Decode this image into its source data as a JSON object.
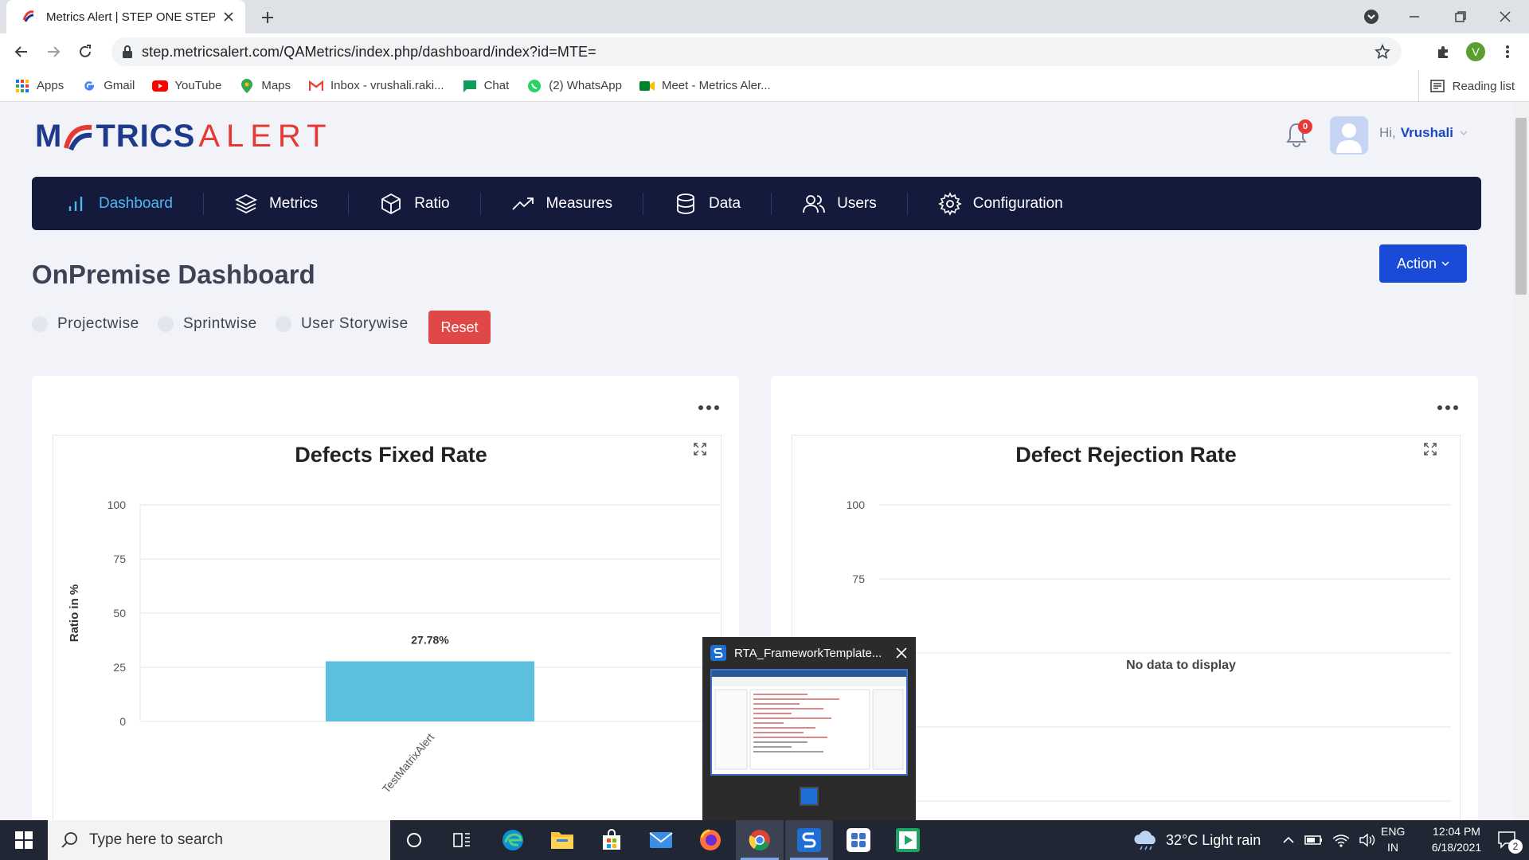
{
  "browser": {
    "tab_title": "Metrics Alert | STEP ONE STEP AHEAD",
    "url": "step.metricsalert.com/QAMetrics/index.php/dashboard/index?id=MTE=",
    "profile_initial": "V",
    "reading_list": "Reading list",
    "bookmarks": [
      {
        "label": "Apps",
        "icon": "apps-grid-icon"
      },
      {
        "label": "Gmail",
        "icon": "google-icon"
      },
      {
        "label": "YouTube",
        "icon": "youtube-icon"
      },
      {
        "label": "Maps",
        "icon": "maps-pin-icon"
      },
      {
        "label": "Inbox - vrushali.raki...",
        "icon": "gmail-icon"
      },
      {
        "label": "Chat",
        "icon": "chat-icon"
      },
      {
        "label": "(2) WhatsApp",
        "icon": "whatsapp-icon"
      },
      {
        "label": "Meet - Metrics Aler...",
        "icon": "meet-icon"
      }
    ]
  },
  "header": {
    "logo_part1": "M",
    "logo_part2": "TRICS",
    "logo_part3": "ALERT",
    "notification_count": "0",
    "greeting": "Hi,",
    "user_name": "Vrushali"
  },
  "nav": [
    {
      "label": "Dashboard",
      "icon": "bar-chart-icon",
      "active": true
    },
    {
      "label": "Metrics",
      "icon": "layers-icon"
    },
    {
      "label": "Ratio",
      "icon": "cube-icon"
    },
    {
      "label": "Measures",
      "icon": "trending-up-icon"
    },
    {
      "label": "Data",
      "icon": "database-icon"
    },
    {
      "label": "Users",
      "icon": "users-icon"
    },
    {
      "label": "Configuration",
      "icon": "gear-icon"
    }
  ],
  "dashboard": {
    "title": "OnPremise Dashboard",
    "action_label": "Action",
    "filters": [
      "Projectwise",
      "Sprintwise",
      "User Storywise"
    ],
    "reset_label": "Reset"
  },
  "chart_data": [
    {
      "type": "bar",
      "title": "Defects Fixed Rate",
      "ylabel": "Ratio in %",
      "xlabel": "",
      "ylim": [
        0,
        100
      ],
      "yticks": [
        0,
        25,
        50,
        75,
        100
      ],
      "categories": [
        "TestMatrixAlert"
      ],
      "values": [
        27.78
      ],
      "data_labels": [
        "27.78%"
      ],
      "color": "#5bc0de",
      "grid": true
    },
    {
      "type": "bar",
      "title": "Defect Rejection Rate",
      "ylabel": "",
      "xlabel": "",
      "ylim": [
        0,
        100
      ],
      "yticks_visible": [
        75,
        100
      ],
      "categories": [],
      "values": [],
      "empty_message": "No data to display",
      "grid": true
    }
  ],
  "popup": {
    "title": "RTA_FrameworkTemplate..."
  },
  "taskbar": {
    "search_placeholder": "Type here to search",
    "weather": "32°C  Light rain",
    "lang_line1": "ENG",
    "lang_line2": "IN",
    "time": "12:04 PM",
    "date": "6/18/2021",
    "notification_count": "2"
  },
  "colors": {
    "nav_bg": "#141a3c",
    "nav_active": "#4fb8f0",
    "action_btn": "#1a4bd8",
    "reset_btn": "#e04848",
    "bar": "#5bc0de"
  }
}
